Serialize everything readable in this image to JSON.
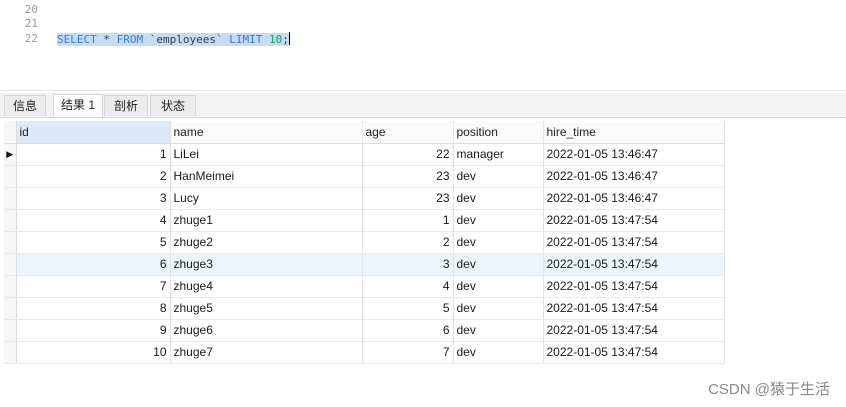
{
  "editor": {
    "line_numbers": [
      "20",
      "21",
      "22"
    ],
    "sql": {
      "kw1": "SELECT",
      "star": " * ",
      "kw2": "FROM",
      "table": " `employees` ",
      "kw3": "LIMIT",
      "space": " ",
      "limit": "10",
      "semi": ";"
    }
  },
  "tabs": [
    "信息",
    "结果 1",
    "剖析",
    "状态"
  ],
  "active_tab": "结果 1",
  "grid": {
    "columns": [
      "id",
      "name",
      "age",
      "position",
      "hire_time"
    ],
    "rows": [
      [
        "1",
        "LiLei",
        "22",
        "manager",
        "2022-01-05 13:46:47"
      ],
      [
        "2",
        "HanMeimei",
        "23",
        "dev",
        "2022-01-05 13:46:47"
      ],
      [
        "3",
        "Lucy",
        "23",
        "dev",
        "2022-01-05 13:46:47"
      ],
      [
        "4",
        "zhuge1",
        "1",
        "dev",
        "2022-01-05 13:47:54"
      ],
      [
        "5",
        "zhuge2",
        "2",
        "dev",
        "2022-01-05 13:47:54"
      ],
      [
        "6",
        "zhuge3",
        "3",
        "dev",
        "2022-01-05 13:47:54"
      ],
      [
        "7",
        "zhuge4",
        "4",
        "dev",
        "2022-01-05 13:47:54"
      ],
      [
        "8",
        "zhuge5",
        "5",
        "dev",
        "2022-01-05 13:47:54"
      ],
      [
        "9",
        "zhuge6",
        "6",
        "dev",
        "2022-01-05 13:47:54"
      ],
      [
        "10",
        "zhuge7",
        "7",
        "dev",
        "2022-01-05 13:47:54"
      ]
    ],
    "current_row_marker": "▶"
  },
  "watermark": "CSDN @猿于生活",
  "colors": {
    "selection": "#c6dcf5",
    "keyword": "#3b78d4",
    "number": "#1a9a5c",
    "sorted_header": "#dce9f7"
  }
}
